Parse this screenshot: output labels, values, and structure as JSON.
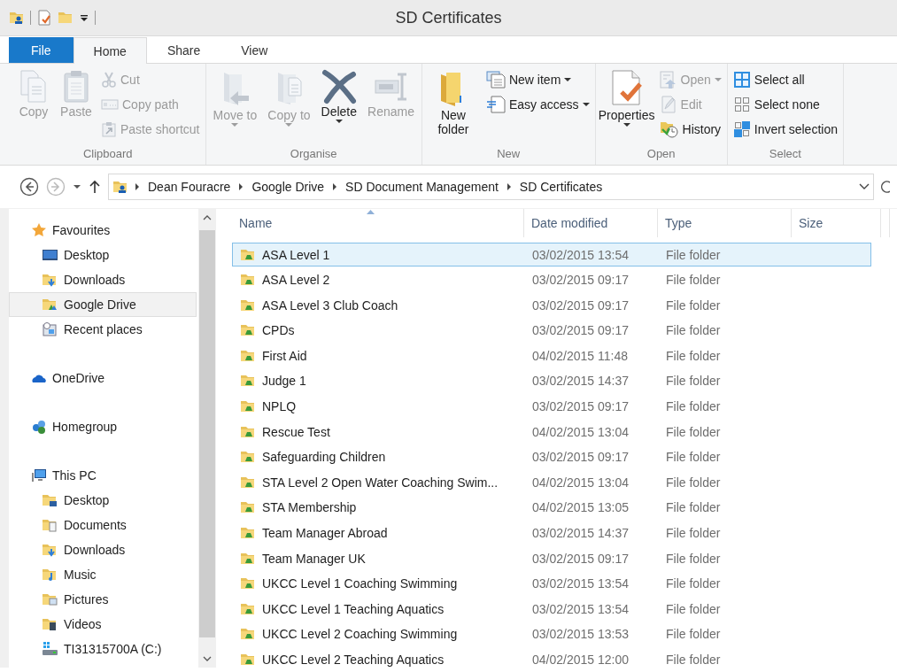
{
  "window": {
    "title": "SD Certificates"
  },
  "tabs": [
    {
      "label": "File",
      "kind": "file",
      "selected": false
    },
    {
      "label": "Home",
      "kind": "tab",
      "selected": true
    },
    {
      "label": "Share",
      "kind": "tab",
      "selected": false
    },
    {
      "label": "View",
      "kind": "tab",
      "selected": false
    }
  ],
  "ribbon": {
    "groups": [
      {
        "label": "Clipboard",
        "items": [
          {
            "kind": "large",
            "label": "Copy",
            "disabled": true,
            "dropdown": false
          },
          {
            "kind": "large",
            "label": "Paste",
            "disabled": true,
            "dropdown": false
          },
          {
            "kind": "stack",
            "items": [
              {
                "label": "Cut",
                "disabled": true,
                "dropdown": false
              },
              {
                "label": "Copy path",
                "disabled": true,
                "dropdown": false
              },
              {
                "label": "Paste shortcut",
                "disabled": true,
                "dropdown": false
              }
            ]
          }
        ]
      },
      {
        "label": "Organise",
        "items": [
          {
            "kind": "large",
            "label": "Move to",
            "disabled": true,
            "dropdown": true
          },
          {
            "kind": "large",
            "label": "Copy to",
            "disabled": true,
            "dropdown": true
          },
          {
            "kind": "large",
            "label": "Delete",
            "disabled": false,
            "dropdown": true
          },
          {
            "kind": "large",
            "label": "Rename",
            "disabled": true,
            "dropdown": false
          }
        ]
      },
      {
        "label": "New",
        "items": [
          {
            "kind": "large",
            "label": "New folder",
            "disabled": false,
            "dropdown": false
          },
          {
            "kind": "stack",
            "items": [
              {
                "label": "New item",
                "disabled": false,
                "dropdown": true
              },
              {
                "label": "Easy access",
                "disabled": false,
                "dropdown": true
              }
            ]
          }
        ]
      },
      {
        "label": "Open",
        "items": [
          {
            "kind": "large",
            "label": "Properties",
            "disabled": false,
            "dropdown": true
          },
          {
            "kind": "stack",
            "items": [
              {
                "label": "Open",
                "disabled": true,
                "dropdown": true
              },
              {
                "label": "Edit",
                "disabled": true,
                "dropdown": false
              },
              {
                "label": "History",
                "disabled": false,
                "dropdown": false
              }
            ]
          }
        ]
      },
      {
        "label": "Select",
        "items": [
          {
            "kind": "stack",
            "items": [
              {
                "label": "Select all",
                "disabled": false,
                "dropdown": false
              },
              {
                "label": "Select none",
                "disabled": false,
                "dropdown": false
              },
              {
                "label": "Invert selection",
                "disabled": false,
                "dropdown": false
              }
            ]
          }
        ]
      }
    ]
  },
  "address": {
    "back_disabled": false,
    "forward_disabled": true,
    "path": [
      "Dean Fouracre",
      "Google Drive",
      "SD Document Management",
      "SD Certificates"
    ]
  },
  "sidebar": {
    "sections": [
      {
        "label": "Favourites",
        "selected": false,
        "children": [
          {
            "label": "Desktop",
            "selected": false
          },
          {
            "label": "Downloads",
            "selected": false
          },
          {
            "label": "Google Drive",
            "selected": true
          },
          {
            "label": "Recent places",
            "selected": false
          }
        ]
      },
      {
        "label": "OneDrive",
        "selected": false
      },
      {
        "label": "Homegroup",
        "selected": false
      },
      {
        "label": "This PC",
        "selected": false,
        "children": [
          {
            "label": "Desktop",
            "selected": false
          },
          {
            "label": "Documents",
            "selected": false
          },
          {
            "label": "Downloads",
            "selected": false
          },
          {
            "label": "Music",
            "selected": false
          },
          {
            "label": "Pictures",
            "selected": false
          },
          {
            "label": "Videos",
            "selected": false
          },
          {
            "label": "TI31315700A (C:)",
            "selected": false
          }
        ]
      }
    ]
  },
  "table": {
    "columns": [
      "Name",
      "Date modified",
      "Type",
      "Size"
    ],
    "rows": [
      {
        "name": "ASA Level 1",
        "date": "03/02/2015 13:54",
        "type": "File folder",
        "selected": true
      },
      {
        "name": "ASA Level 2",
        "date": "03/02/2015 09:17",
        "type": "File folder",
        "selected": false
      },
      {
        "name": "ASA Level 3 Club Coach",
        "date": "03/02/2015 09:17",
        "type": "File folder",
        "selected": false
      },
      {
        "name": "CPDs",
        "date": "03/02/2015 09:17",
        "type": "File folder",
        "selected": false
      },
      {
        "name": "First Aid",
        "date": "04/02/2015 11:48",
        "type": "File folder",
        "selected": false
      },
      {
        "name": "Judge 1",
        "date": "03/02/2015 14:37",
        "type": "File folder",
        "selected": false
      },
      {
        "name": "NPLQ",
        "date": "03/02/2015 09:17",
        "type": "File folder",
        "selected": false
      },
      {
        "name": "Rescue Test",
        "date": "04/02/2015 13:04",
        "type": "File folder",
        "selected": false
      },
      {
        "name": "Safeguarding Children",
        "date": "03/02/2015 09:17",
        "type": "File folder",
        "selected": false
      },
      {
        "name": "STA Level 2 Open Water Coaching Swim...",
        "date": "04/02/2015 13:04",
        "type": "File folder",
        "selected": false
      },
      {
        "name": "STA Membership",
        "date": "04/02/2015 13:05",
        "type": "File folder",
        "selected": false
      },
      {
        "name": "Team Manager Abroad",
        "date": "03/02/2015 14:37",
        "type": "File folder",
        "selected": false
      },
      {
        "name": "Team Manager UK",
        "date": "03/02/2015 09:17",
        "type": "File folder",
        "selected": false
      },
      {
        "name": "UKCC Level 1 Coaching Swimming",
        "date": "03/02/2015 13:54",
        "type": "File folder",
        "selected": false
      },
      {
        "name": "UKCC Level 1 Teaching Aquatics",
        "date": "03/02/2015 13:54",
        "type": "File folder",
        "selected": false
      },
      {
        "name": "UKCC Level 2 Coaching Swimming",
        "date": "03/02/2015 13:53",
        "type": "File folder",
        "selected": false
      },
      {
        "name": "UKCC Level 2 Teaching Aquatics",
        "date": "04/02/2015 12:00",
        "type": "File folder",
        "selected": false
      }
    ]
  }
}
